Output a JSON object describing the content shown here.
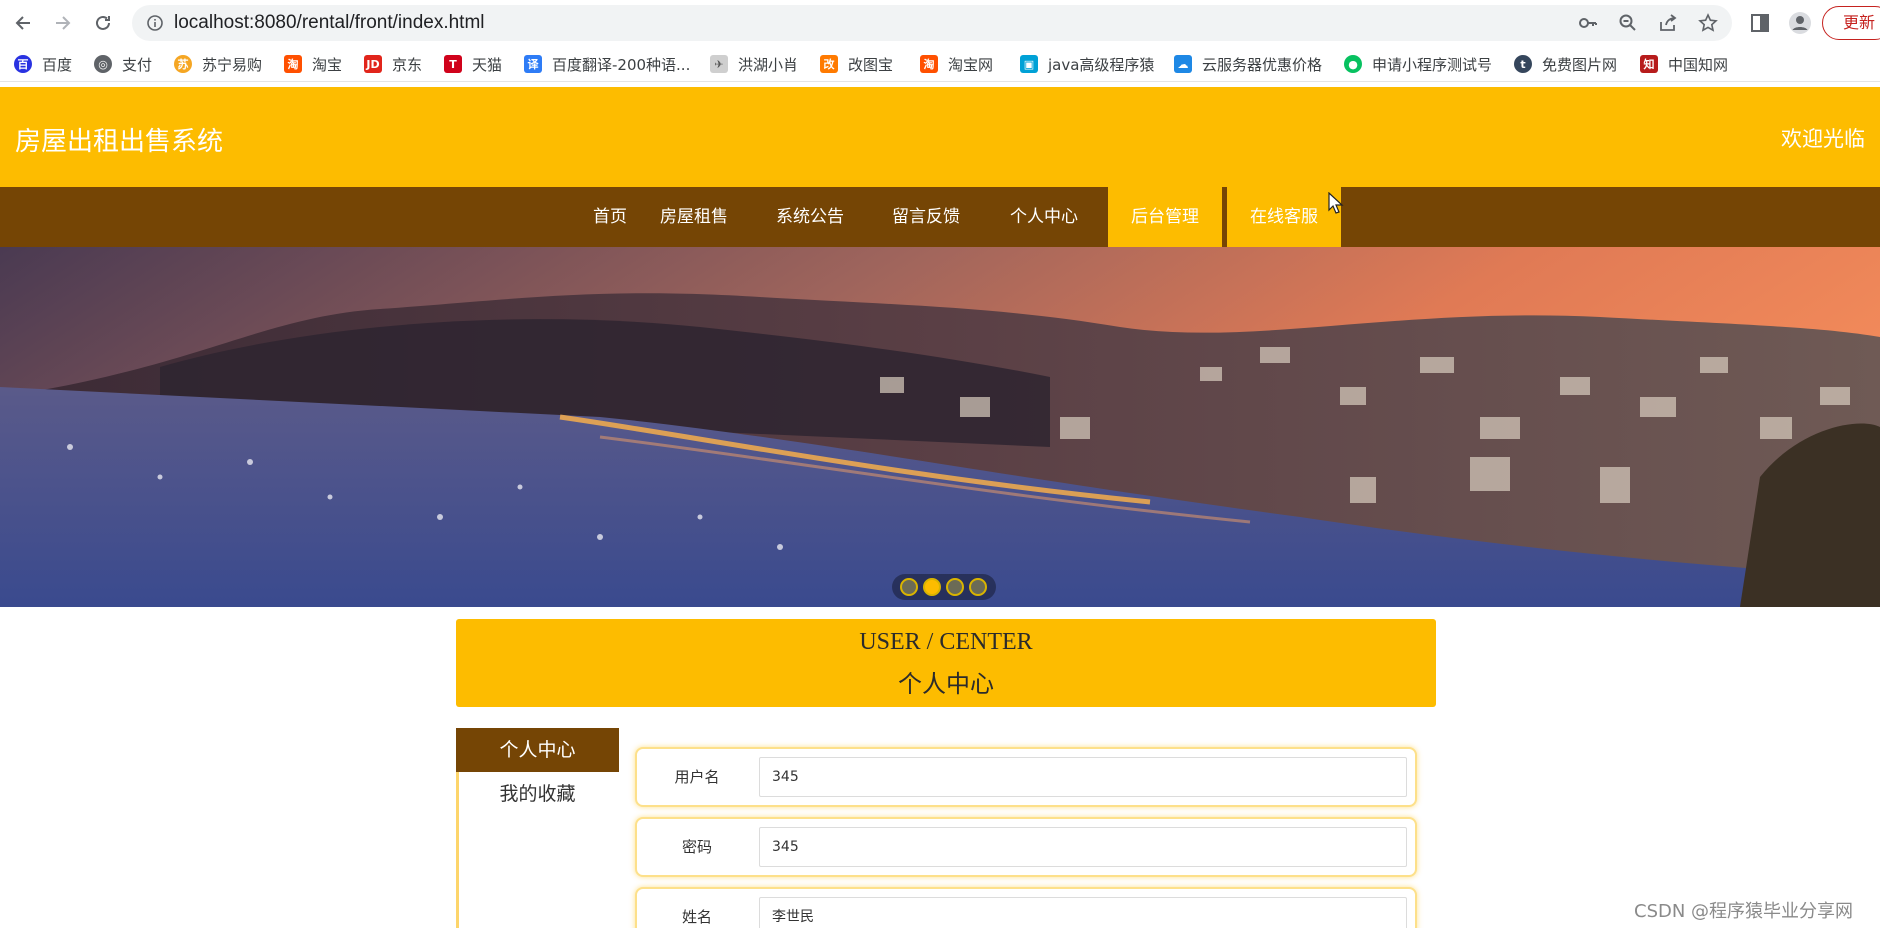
{
  "browser": {
    "url": "localhost:8080/rental/front/index.html",
    "update_label": "更新",
    "bookmarks": [
      {
        "label": "百度",
        "icon": "baidu-icon",
        "color": "#2932e1"
      },
      {
        "label": "支付",
        "icon": "globe-icon",
        "color": "#5f6368"
      },
      {
        "label": "苏宁易购",
        "icon": "suning-icon",
        "color": "#f5a623"
      },
      {
        "label": "淘宝",
        "icon": "taobao-icon",
        "color": "#ff5000"
      },
      {
        "label": "京东",
        "icon": "jd-icon",
        "color": "#e1251b"
      },
      {
        "label": "天猫",
        "icon": "tmall-icon",
        "color": "#d0021b"
      },
      {
        "label": "百度翻译-200种语...",
        "icon": "translate-icon",
        "color": "#2e7cf6"
      },
      {
        "label": "洪湖小肖",
        "icon": "wing-icon",
        "color": "#666666"
      },
      {
        "label": "改图宝",
        "icon": "gaitubao-icon",
        "color": "#ff7a00"
      },
      {
        "label": "淘宝网",
        "icon": "taobao-icon",
        "color": "#ff5000"
      },
      {
        "label": "java高级程序猿",
        "icon": "bilibili-icon",
        "color": "#00a1d6"
      },
      {
        "label": "云服务器优惠价格",
        "icon": "cloud-icon",
        "color": "#1e88e5"
      },
      {
        "label": "申请小程序测试号",
        "icon": "wechat-icon",
        "color": "#07c160"
      },
      {
        "label": "免费图片网",
        "icon": "tumblr-icon",
        "color": "#35465c"
      },
      {
        "label": "中国知网",
        "icon": "cnki-icon",
        "color": "#b71c1c"
      }
    ]
  },
  "header": {
    "site_title": "房屋出租出售系统",
    "welcome": "欢迎光临",
    "brand_color": "#fdbc00",
    "nav_color": "#754505"
  },
  "nav": [
    {
      "label": "首页",
      "active": false
    },
    {
      "label": "房屋租售",
      "active": false
    },
    {
      "label": "系统公告",
      "active": false
    },
    {
      "label": "留言反馈",
      "active": false
    },
    {
      "label": "个人中心",
      "active": false
    },
    {
      "label": "后台管理",
      "active": true
    },
    {
      "label": "在线客服",
      "active": true
    }
  ],
  "carousel": {
    "slides": 4,
    "active_index": 1
  },
  "user_center": {
    "title_en": "USER / CENTER",
    "title_cn": "个人中心",
    "menu": [
      {
        "label": "个人中心",
        "active": true
      },
      {
        "label": "我的收藏",
        "active": false
      }
    ],
    "fields": [
      {
        "label": "用户名",
        "value": "345"
      },
      {
        "label": "密码",
        "value": "345"
      },
      {
        "label": "姓名",
        "value": "李世民"
      }
    ]
  },
  "watermark": "CSDN @程序猿毕业分享网"
}
